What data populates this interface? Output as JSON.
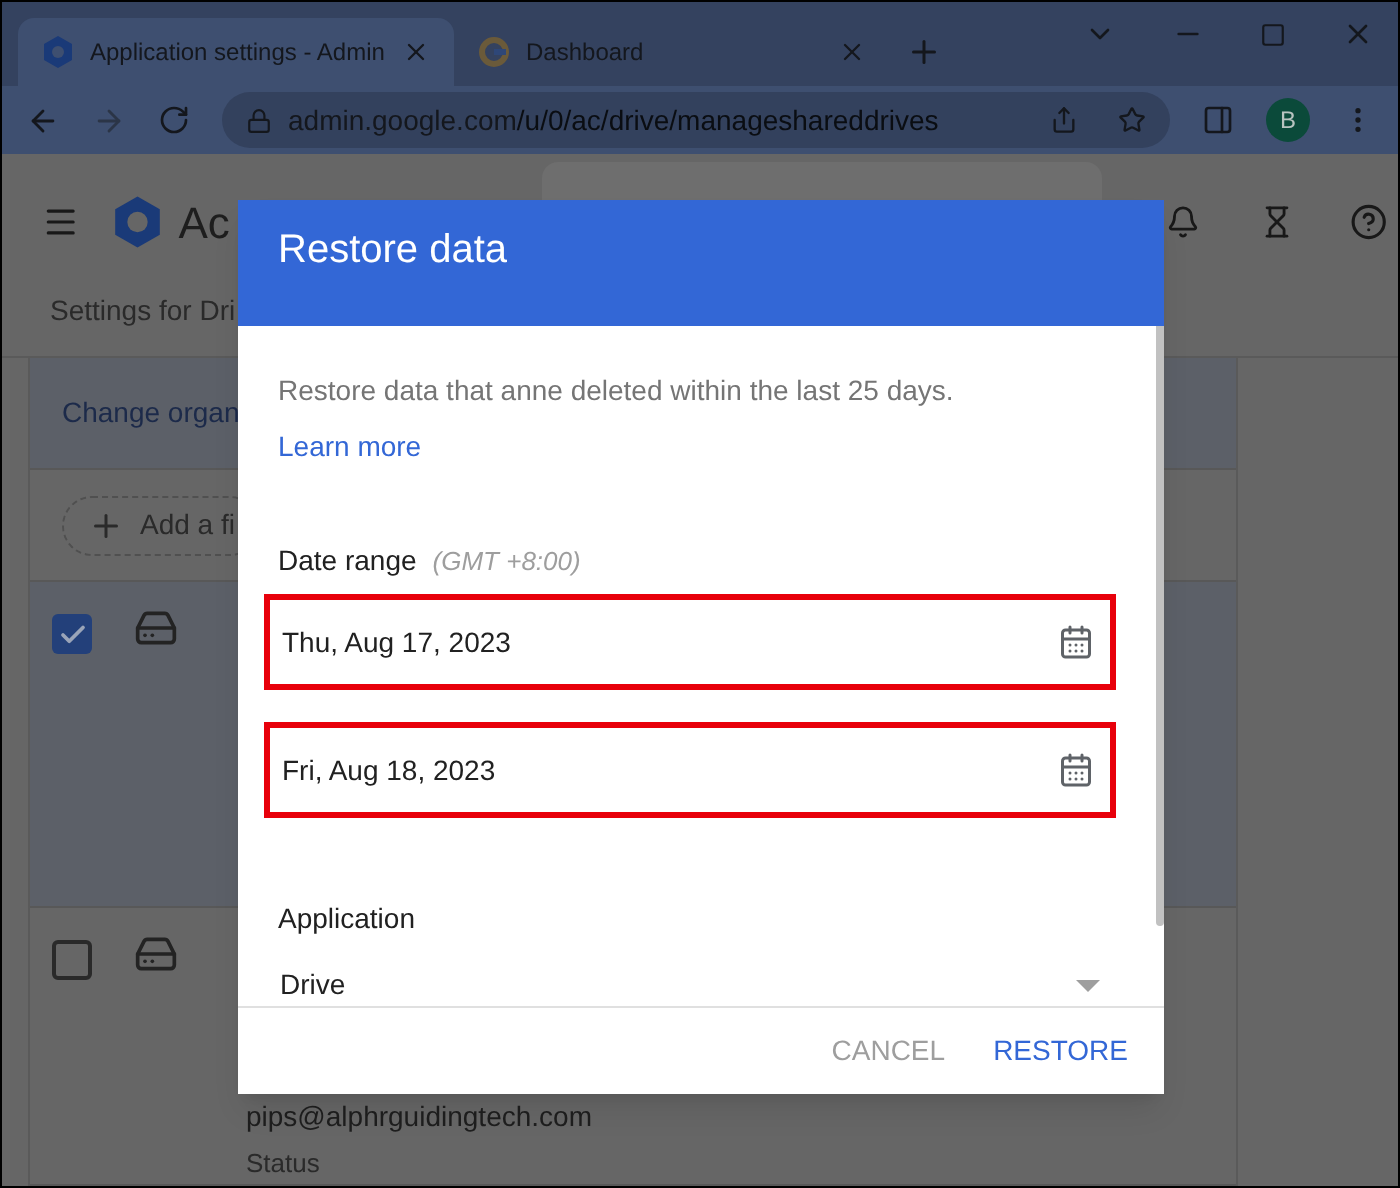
{
  "browser": {
    "tabs": [
      {
        "title": "Application settings - Admin",
        "selected": true,
        "kind": "admin"
      },
      {
        "title": "Dashboard",
        "selected": false,
        "kind": "google"
      }
    ],
    "url_host": "admin.google.com",
    "url_path": "/u/0/ac/drive/manageshareddrives",
    "profile_initial": "B"
  },
  "admin": {
    "app_title": "Ac",
    "subtitle": "Settings for Dri",
    "change_link": "Change organ",
    "add_filter": "Add a fi",
    "rows": [
      {
        "checked": true
      },
      {
        "checked": false,
        "email": "pips@alphrguidingtech.com",
        "status_label": "Status"
      }
    ]
  },
  "dialog": {
    "title": "Restore data",
    "description": "Restore data that anne deleted within the last 25 days.",
    "learn_more": "Learn more",
    "date_range_label": "Date range",
    "timezone": "(GMT +8:00)",
    "dates": [
      {
        "value": "Thu, Aug 17, 2023",
        "highlighted": true
      },
      {
        "value": "Fri, Aug 18, 2023",
        "highlighted": true
      }
    ],
    "application_label": "Application",
    "application_value": "Drive",
    "buttons": [
      {
        "label": "CANCEL",
        "kind": "secondary"
      },
      {
        "label": "RESTORE",
        "kind": "primary"
      }
    ]
  }
}
